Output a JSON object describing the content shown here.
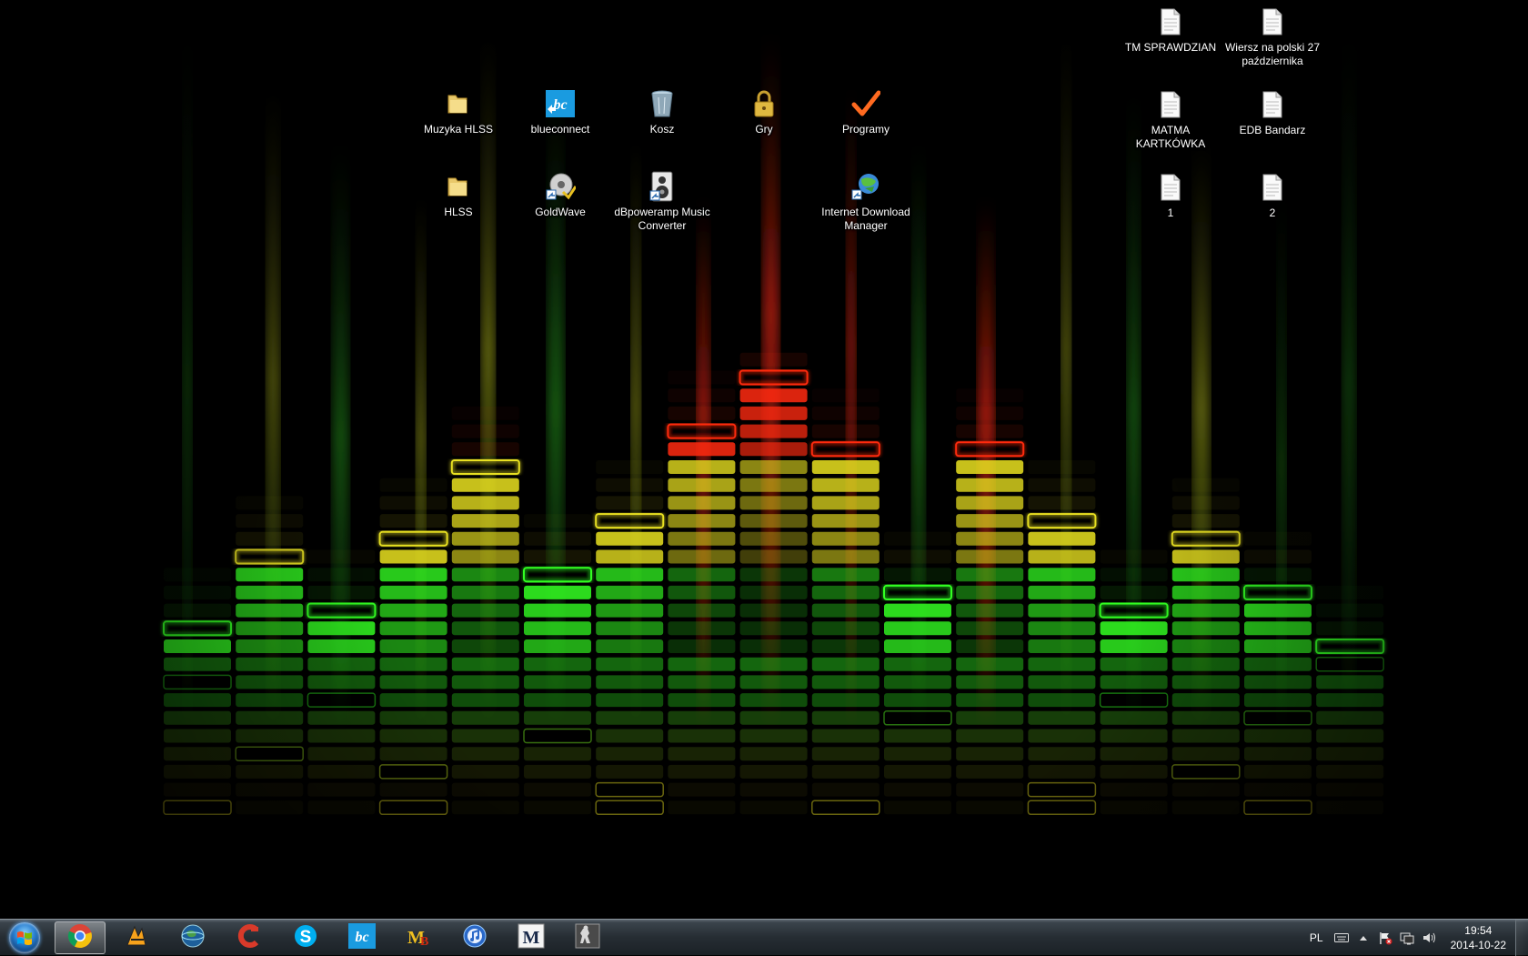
{
  "desktop": {
    "icons": [
      {
        "id": "muzyka-hlss",
        "label": "Muzyka HLSS",
        "icon": "folder-icon"
      },
      {
        "id": "blueconnect",
        "label": "blueconnect",
        "icon": "blueconnect-icon"
      },
      {
        "id": "kosz",
        "label": "Kosz",
        "icon": "recycle-bin-icon"
      },
      {
        "id": "gry",
        "label": "Gry",
        "icon": "lock-icon"
      },
      {
        "id": "programy",
        "label": "Programy",
        "icon": "checkmark-icon"
      },
      {
        "id": "hlss",
        "label": "HLSS",
        "icon": "folder-icon"
      },
      {
        "id": "goldwave",
        "label": "GoldWave",
        "icon": "goldwave-icon"
      },
      {
        "id": "dbpoweramp",
        "label": "dBpoweramp Music Converter",
        "icon": "dbpoweramp-icon"
      },
      {
        "id": "idm",
        "label": "Internet Download Manager",
        "icon": "idm-icon"
      },
      {
        "id": "tm-sprawdzian",
        "label": "TM SPRAWDZIAN",
        "icon": "document-icon"
      },
      {
        "id": "wiersz",
        "label": "Wiersz na polski 27 października",
        "icon": "document-icon"
      },
      {
        "id": "matma",
        "label": "MATMA KARTKÓWKA",
        "icon": "document-icon"
      },
      {
        "id": "edb",
        "label": "EDB Bandarz",
        "icon": "document-icon"
      },
      {
        "id": "doc-1",
        "label": "1",
        "icon": "document-icon"
      },
      {
        "id": "doc-2",
        "label": "2",
        "icon": "document-icon"
      }
    ]
  },
  "wallpaper": {
    "equalizer_levels": [
      1,
      5,
      2,
      6,
      10,
      4,
      7,
      12,
      15,
      11,
      3,
      11,
      7,
      2,
      6,
      3,
      0
    ],
    "colors": {
      "green": "#33ff22",
      "yellow": "#e8e020",
      "red": "#ff2a10"
    }
  },
  "taskbar": {
    "start_icon": "windows-start-icon",
    "apps": [
      {
        "id": "chrome",
        "icon": "chrome-icon",
        "active": true
      },
      {
        "id": "winamp",
        "icon": "winamp-icon",
        "active": false
      },
      {
        "id": "earth",
        "icon": "globe-icon",
        "active": false
      },
      {
        "id": "ccleaner",
        "icon": "ccleaner-icon",
        "active": false
      },
      {
        "id": "skype",
        "icon": "skype-icon",
        "active": false
      },
      {
        "id": "blueconnect",
        "icon": "blueconnect-icon",
        "active": false
      },
      {
        "id": "mb",
        "icon": "mb-icon",
        "active": false
      },
      {
        "id": "itunes",
        "icon": "music-icon",
        "active": false
      },
      {
        "id": "metin",
        "icon": "m-icon",
        "active": false
      },
      {
        "id": "counter-strike",
        "icon": "cs-icon",
        "active": false
      }
    ],
    "tray": {
      "language": "PL",
      "time": "19:54",
      "date": "2014-10-22"
    }
  }
}
